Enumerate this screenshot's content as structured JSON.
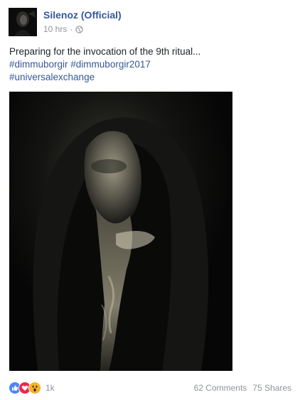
{
  "post": {
    "author": "Silenoz (Official)",
    "time": "10 hrs",
    "separator": "·",
    "privacy_icon": "globe-icon",
    "text": "Preparing for the invocation of the 9th ritual...",
    "hashtags_line1": [
      "#dimmuborgir",
      "#dimmuborgir2017"
    ],
    "hashtags_line2": [
      "#universalexchange"
    ]
  },
  "footer": {
    "reaction_icons": [
      "like-icon",
      "love-icon",
      "wow-icon"
    ],
    "reaction_count": "1k",
    "comments": "62 Comments",
    "shares": "75 Shares"
  },
  "colors": {
    "link": "#365899",
    "meta": "#90949c",
    "text": "#1d2129",
    "like": "#4c84ff",
    "love": "#f0284a",
    "wow": "#f7b125"
  }
}
